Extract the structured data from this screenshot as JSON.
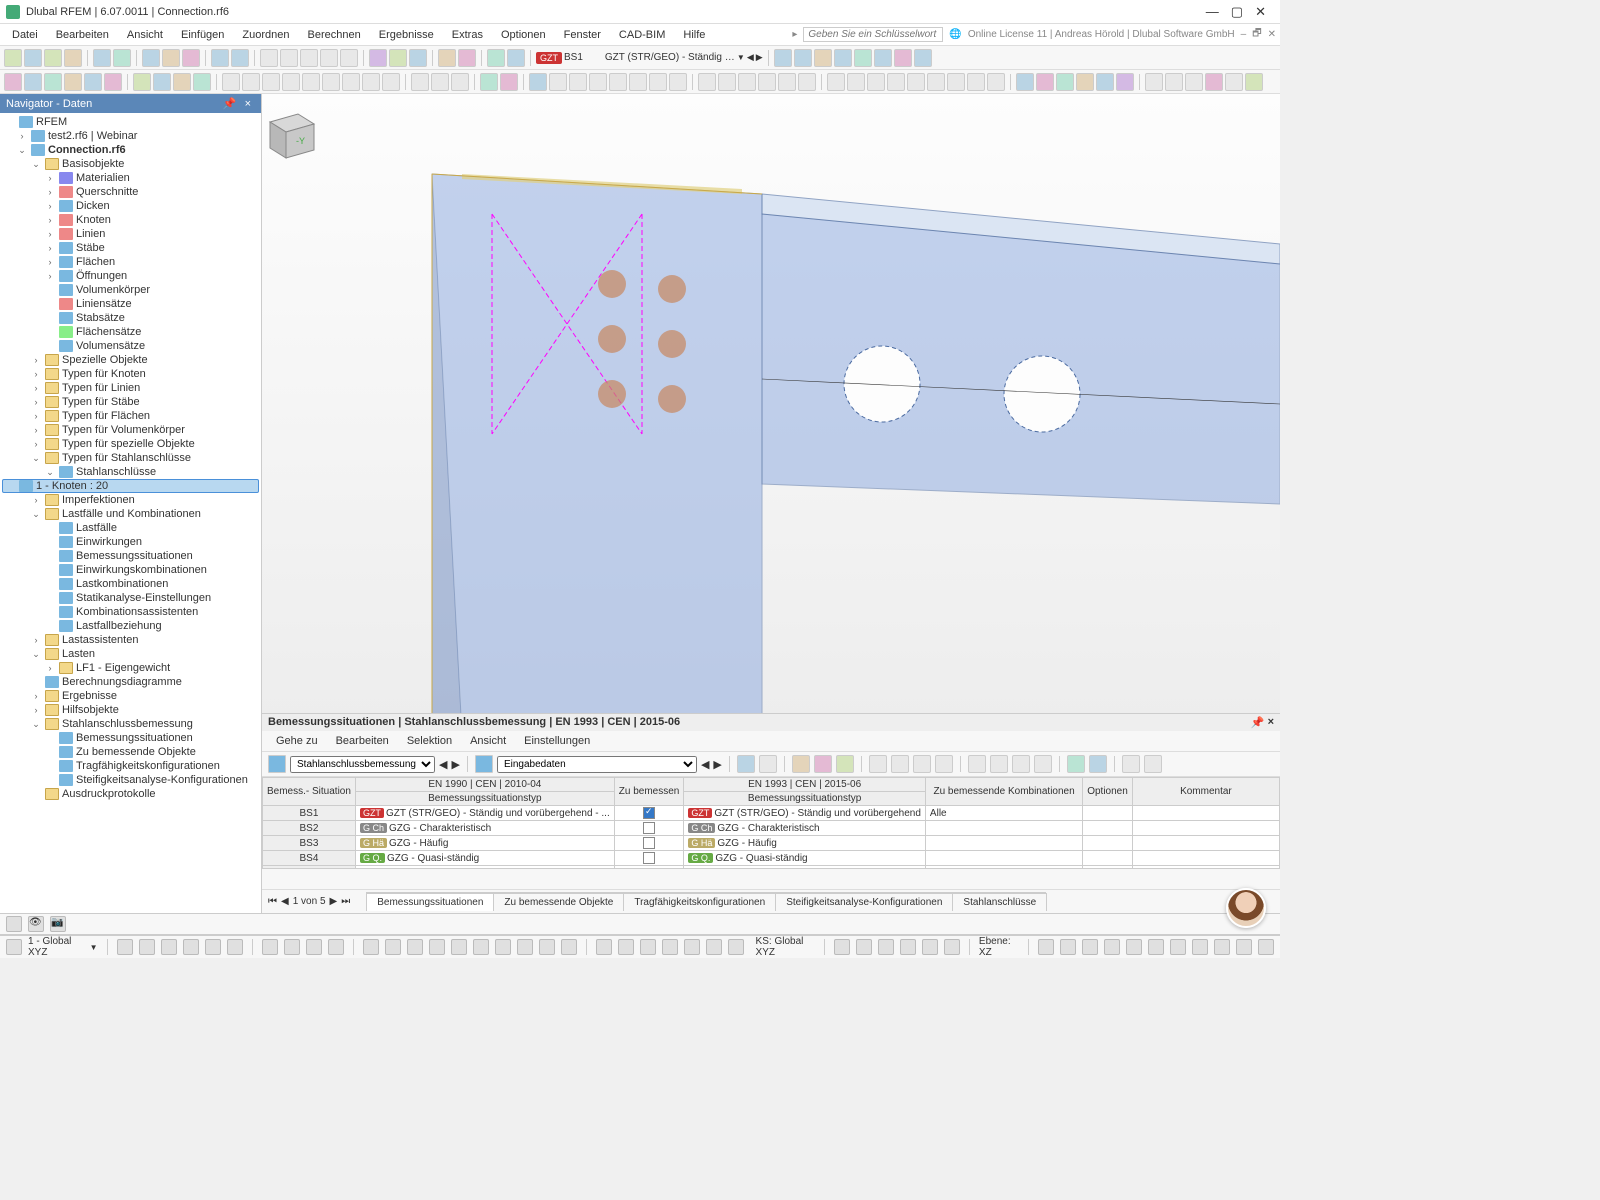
{
  "title": "Dlubal RFEM | 6.07.0011 | Connection.rf6",
  "menu": [
    "Datei",
    "Bearbeiten",
    "Ansicht",
    "Einfügen",
    "Zuordnen",
    "Berechnen",
    "Ergebnisse",
    "Extras",
    "Optionen",
    "Fenster",
    "CAD-BIM",
    "Hilfe"
  ],
  "search_placeholder": "Geben Sie ein Schlüsselwort ein (Alt...",
  "license": "Online License 11 | Andreas Hörold | Dlubal Software GmbH",
  "loadcase_badge": "GZT",
  "loadcase_sel1": "BS1",
  "loadcase_sel2": "GZT (STR/GEO) - Ständig un…",
  "nav_title": "Navigator - Daten",
  "tree": {
    "root": "RFEM",
    "files": [
      "test2.rf6 | Webinar",
      "Connection.rf6"
    ],
    "basis": "Basisobjekte",
    "basis_items": [
      "Materialien",
      "Querschnitte",
      "Dicken",
      "Knoten",
      "Linien",
      "Stäbe",
      "Flächen",
      "Öffnungen",
      "Volumenkörper",
      "Liniensätze",
      "Stabsätze",
      "Flächensätze",
      "Volumensätze"
    ],
    "typ": [
      "Spezielle Objekte",
      "Typen für Knoten",
      "Typen für Linien",
      "Typen für Stäbe",
      "Typen für Flächen",
      "Typen für Volumenkörper",
      "Typen für spezielle Objekte",
      "Typen für Stahlanschlüsse"
    ],
    "stahl": "Stahlanschlüsse",
    "stahl_sel": "1 - Knoten : 20",
    "imperfekt": "Imperfektionen",
    "lastfalle": "Lastfälle und Kombinationen",
    "lastfalle_items": [
      "Lastfälle",
      "Einwirkungen",
      "Bemessungssituationen",
      "Einwirkungskombinationen",
      "Lastkombinationen",
      "Statikanalyse-Einstellungen",
      "Kombinationsassistenten",
      "Lastfallbeziehung"
    ],
    "more": [
      "Lastassistenten",
      "Lasten"
    ],
    "lf1": "LF1 - Eigengewicht",
    "berech": "Berechnungsdiagramme",
    "erg": [
      "Ergebnisse",
      "Hilfsobjekte",
      "Stahlanschlussbemessung"
    ],
    "stahlbem": [
      "Bemessungssituationen",
      "Zu bemessende Objekte",
      "Tragfähigkeitskonfigurationen",
      "Steifigkeitsanalyse-Konfigurationen"
    ],
    "ausdruck": "Ausdruckprotokolle"
  },
  "panel": {
    "title": "Bemessungssituationen | Stahlanschlussbemessung | EN 1993 | CEN | 2015-06",
    "menu": [
      "Gehe zu",
      "Bearbeiten",
      "Selektion",
      "Ansicht",
      "Einstellungen"
    ],
    "combo1": "Stahlanschlussbemessung",
    "combo2": "Eingabedaten",
    "headers": {
      "sit": "Bemess.-\nSituation",
      "h1990": "EN 1990 | CEN | 2010-04",
      "h1990s": "Bemessungssituationstyp",
      "zb": "Zu\nbemessen",
      "h1993": "EN 1993 | CEN | 2015-06",
      "h1993s": "Bemessungssituationstyp",
      "komb": "Zu bemessende Kombinationen",
      "opt": "Optionen",
      "komm": "Kommentar"
    },
    "rows": [
      {
        "id": "BS1",
        "b": "GZT",
        "t1": "GZT (STR/GEO) - Ständig und vorübergehend - ...",
        "chk": true,
        "b2": "GZT",
        "t2": "GZT (STR/GEO) - Ständig und vorübergehend",
        "komb": "Alle"
      },
      {
        "id": "BS2",
        "b": "G Ch",
        "bc": "bg-gray",
        "t1": "GZG - Charakteristisch",
        "chk": false,
        "b2": "G Ch",
        "t2": "GZG - Charakteristisch",
        "komb": ""
      },
      {
        "id": "BS3",
        "b": "G Hä",
        "bc": "bg-tan",
        "t1": "GZG - Häufig",
        "chk": false,
        "b2": "G Hä",
        "t2": "GZG - Häufig",
        "komb": ""
      },
      {
        "id": "BS4",
        "b": "G Q.",
        "bc": "bg-grn",
        "t1": "GZG - Quasi-ständig",
        "chk": false,
        "b2": "G Q.",
        "t2": "GZG - Quasi-ständig",
        "komb": ""
      }
    ],
    "pager": "1 von 5",
    "tabs": [
      "Bemessungssituationen",
      "Zu bemessende Objekte",
      "Tragfähigkeitskonfigurationen",
      "Steifigkeitsanalyse-Konfigurationen",
      "Stahlanschlüsse"
    ]
  },
  "status": {
    "cs": "1 - Global XYZ",
    "ks": "KS: Global XYZ",
    "ebene": "Ebene: XZ"
  }
}
